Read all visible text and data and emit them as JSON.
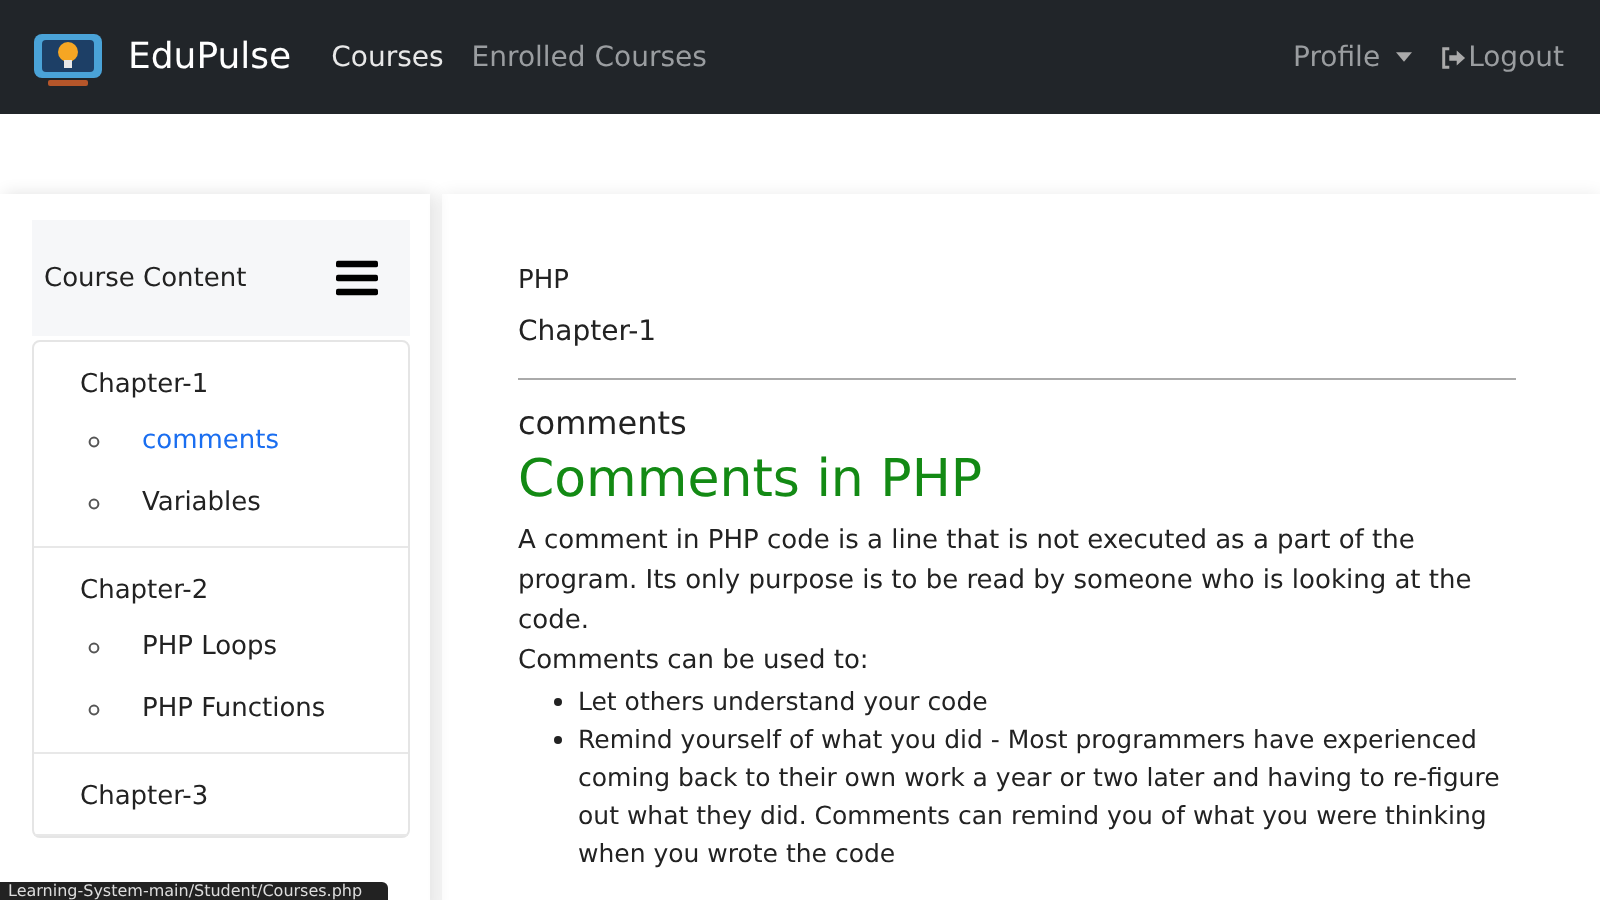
{
  "navbar": {
    "brand": "EduPulse",
    "links": [
      {
        "label": "Courses",
        "selected": true
      },
      {
        "label": "Enrolled Courses",
        "selected": false
      }
    ],
    "profile": "Profile",
    "logout": "Logout"
  },
  "sidebar": {
    "title": "Course Content",
    "chapters": [
      {
        "title": "Chapter-1",
        "items": [
          {
            "label": "comments",
            "selected": true
          },
          {
            "label": "Variables",
            "selected": false
          }
        ]
      },
      {
        "title": "Chapter-2",
        "items": [
          {
            "label": "PHP Loops",
            "selected": false
          },
          {
            "label": "PHP Functions",
            "selected": false
          }
        ]
      },
      {
        "title": "Chapter-3"
      }
    ]
  },
  "content": {
    "course": "PHP",
    "chapter": "Chapter-1",
    "topic": "comments",
    "heading": "Comments in PHP",
    "paragraphs": [
      "A comment in PHP code is a line that is not executed as a part of the program. Its only purpose is to be read by someone who is looking at the code.",
      "Comments can be used to:"
    ],
    "bullets": [
      "Let others understand your code",
      "Remind yourself of what you did - Most programmers have experienced coming back to their own work a year or two later and having to re-figure out what they did. Comments can remind you of what you were thinking when you wrote the code"
    ]
  },
  "status_bar": {
    "url": "Learning-System-main/Student/Courses.php"
  }
}
